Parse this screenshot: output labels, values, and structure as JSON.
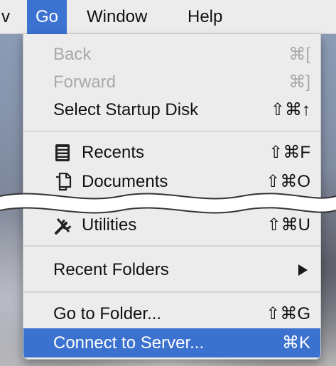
{
  "menubar": {
    "items": [
      {
        "label": "v"
      },
      {
        "label": "Go"
      },
      {
        "label": "Window"
      },
      {
        "label": "Help"
      }
    ]
  },
  "menu": {
    "items": [
      {
        "label": "Back",
        "shortcut": "⌘[",
        "enabled": false
      },
      {
        "label": "Forward",
        "shortcut": "⌘]",
        "enabled": false
      },
      {
        "label": "Select Startup Disk",
        "shortcut": "⇧⌘↑",
        "enabled": true
      },
      {
        "label": "Recents",
        "shortcut": "⇧⌘F",
        "icon": "recents-icon"
      },
      {
        "label": "Documents",
        "shortcut": "⇧⌘O",
        "icon": "documents-icon"
      },
      {
        "label": "Utilities",
        "shortcut": "⇧⌘U",
        "icon": "utilities-icon"
      },
      {
        "label": "Recent Folders",
        "submenu": true
      },
      {
        "label": "Go to Folder...",
        "shortcut": "⇧⌘G"
      },
      {
        "label": "Connect to Server...",
        "shortcut": "⌘K",
        "highlighted": true
      }
    ]
  },
  "colors": {
    "menu_bg": "#ececec",
    "highlight": "#3c72cf",
    "disabled_text": "#a9a9a9"
  }
}
